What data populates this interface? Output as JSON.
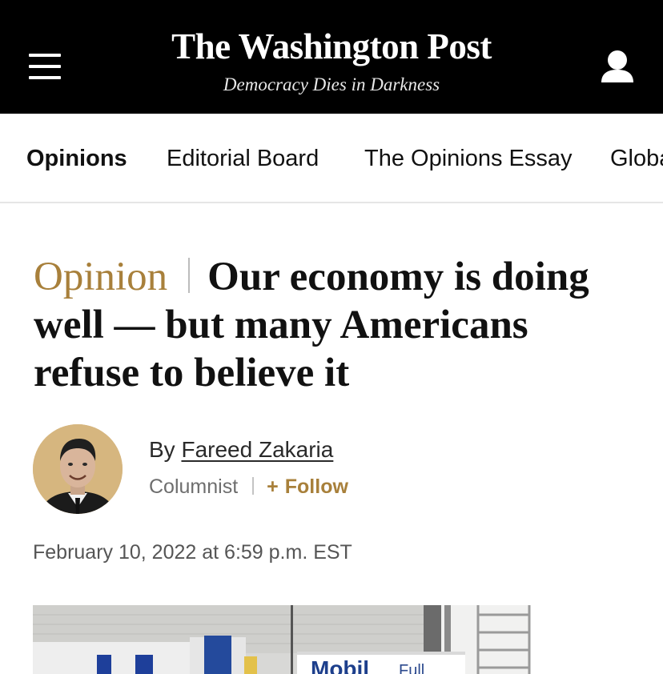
{
  "header": {
    "brand": "The Washington Post",
    "tagline": "Democracy Dies in Darkness",
    "menu_icon": "hamburger-menu-icon",
    "account_icon": "user-account-icon",
    "background": "#000000"
  },
  "nav": {
    "items": [
      {
        "label": "Opinions",
        "active": true
      },
      {
        "label": "Editorial Board",
        "active": false
      },
      {
        "label": "The Opinions Essay",
        "active": false
      },
      {
        "label": "Global Opinions",
        "active": false
      }
    ]
  },
  "article": {
    "kicker": "Opinion",
    "headline": "Our economy is doing well — but many Americans refuse to believe it",
    "byline_prefix": "By",
    "author": "Fareed Zakaria",
    "author_role": "Columnist",
    "follow_label": "Follow",
    "follow_symbol": "+",
    "timestamp": "February 10, 2022 at 6:59 p.m. EST",
    "lead_image_text": {
      "brand": "Mobil",
      "sign": "Full"
    }
  },
  "colors": {
    "accent_gold": "#a8803b",
    "text": "#111111",
    "muted": "#6e6e6e"
  }
}
